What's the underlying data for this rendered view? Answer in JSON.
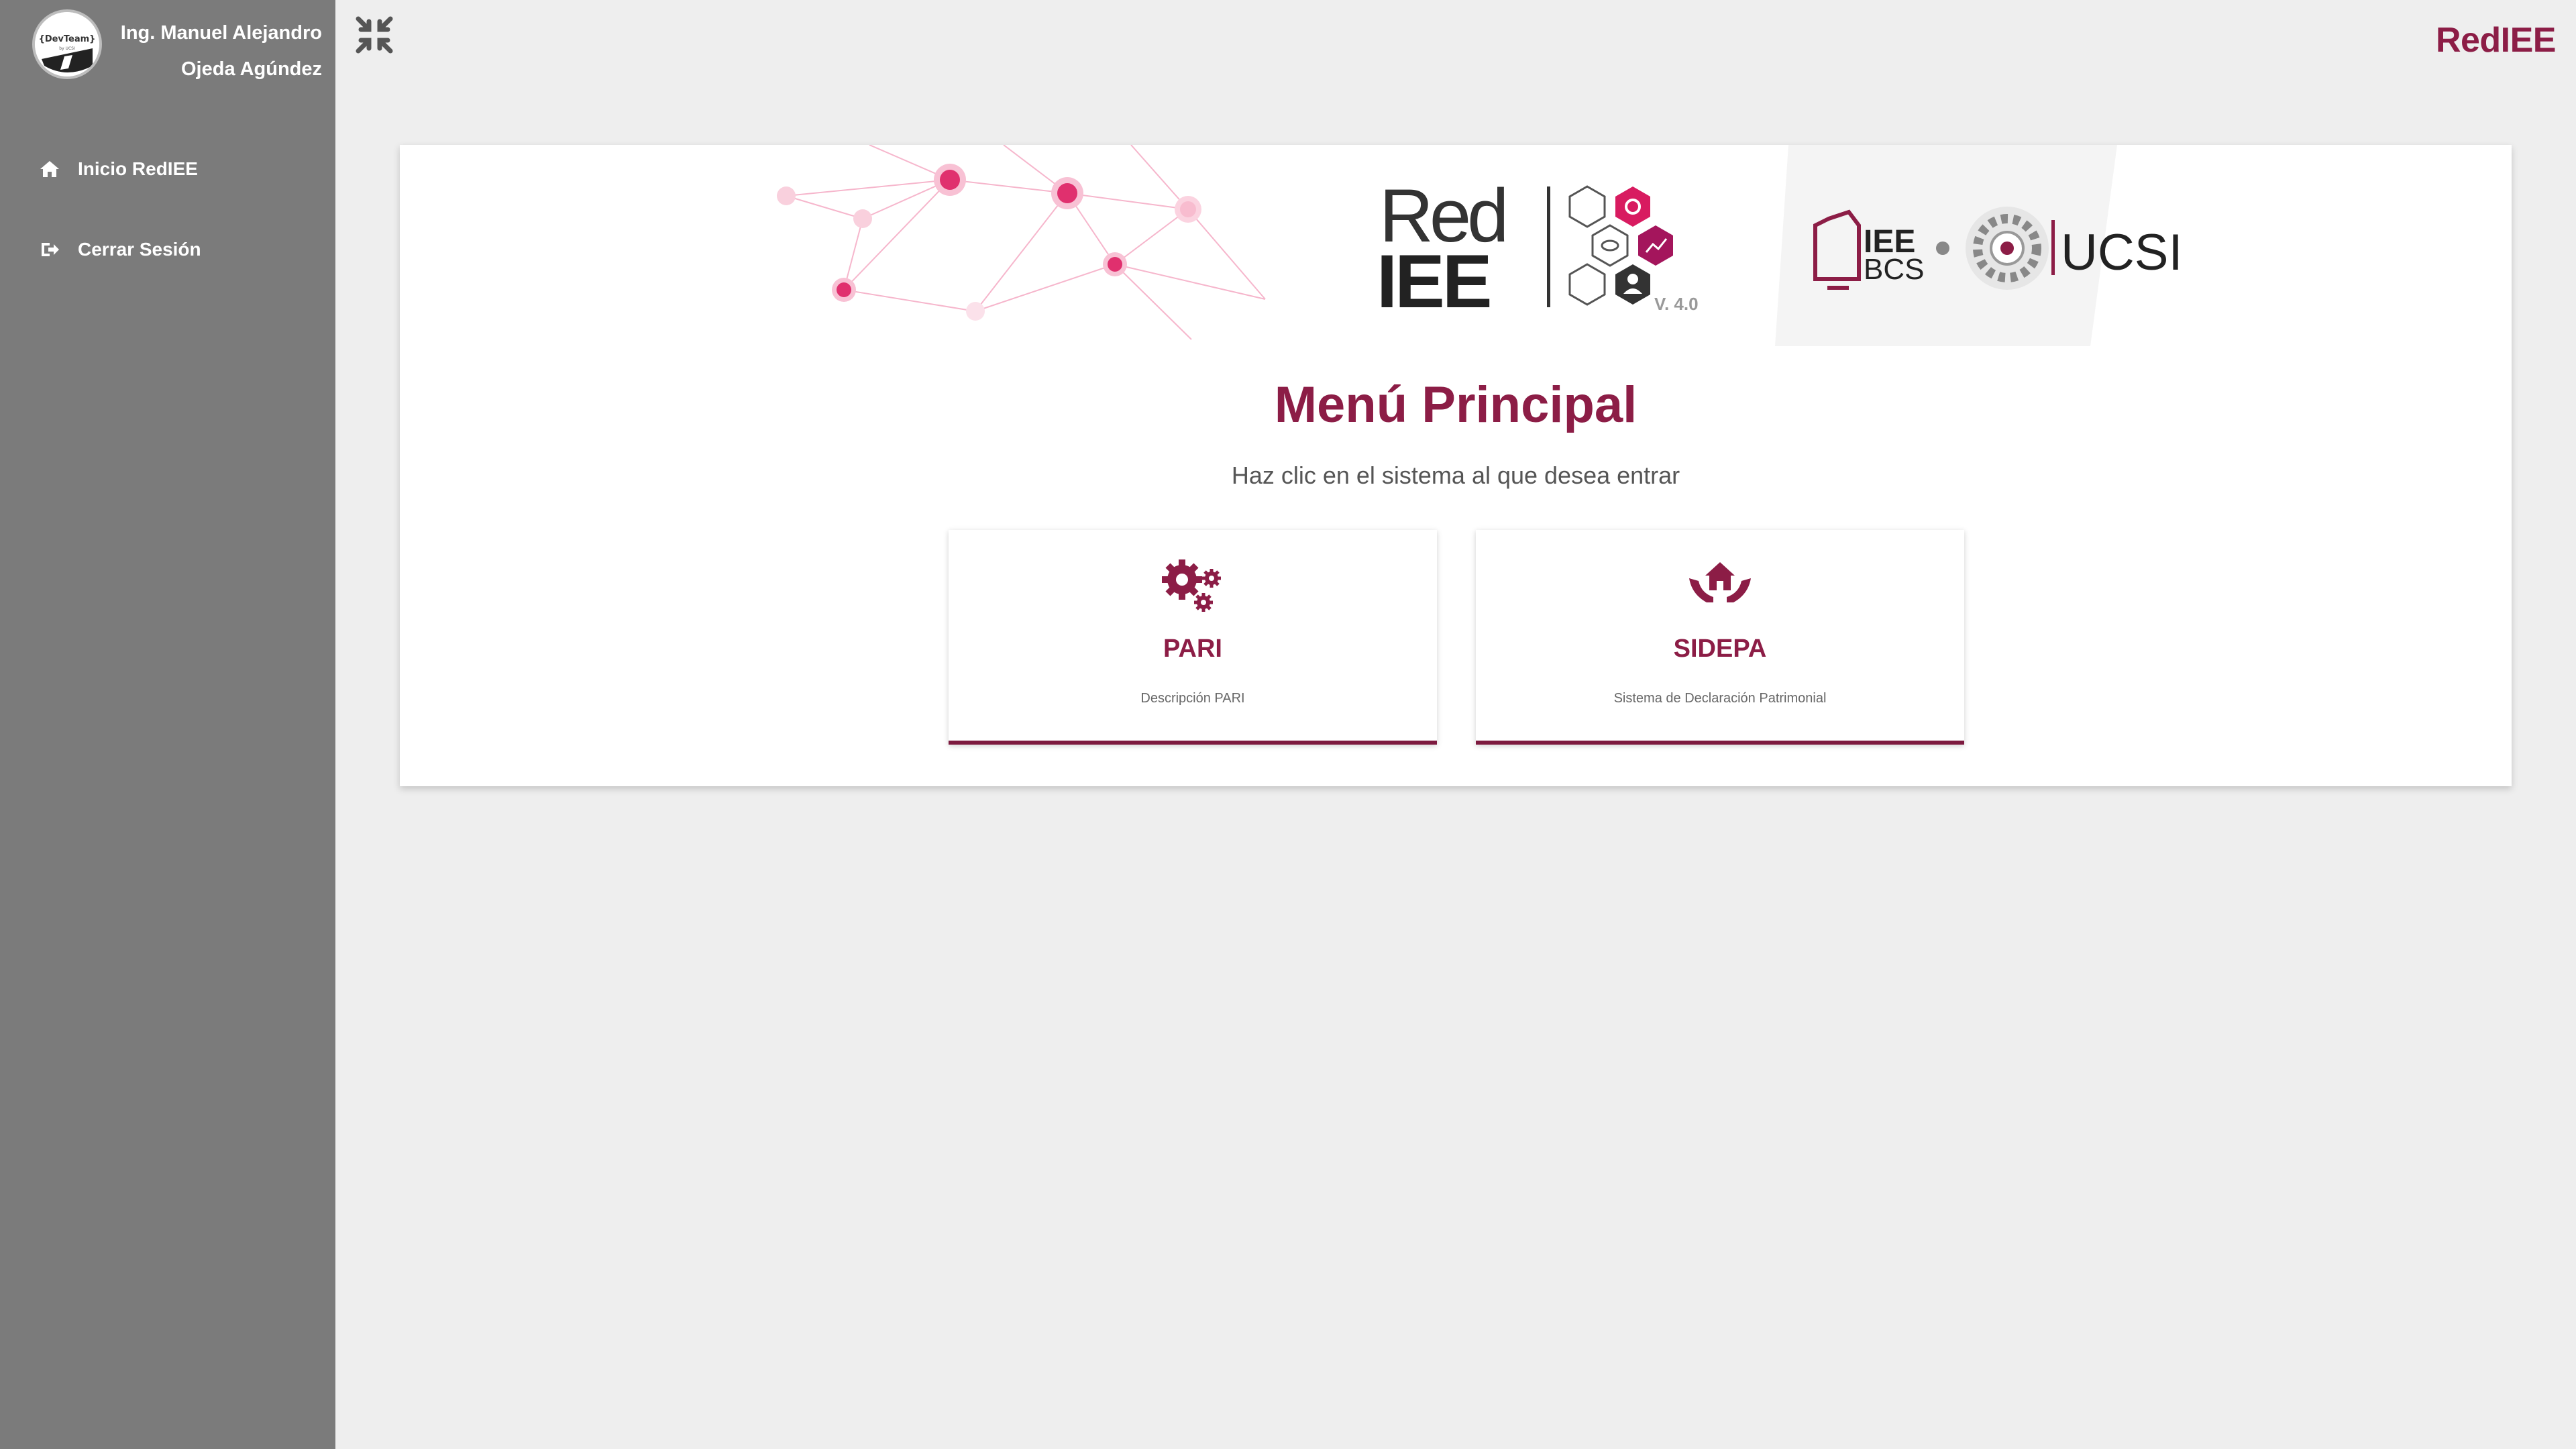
{
  "user": {
    "name_line1": "Ing. Manuel Alejandro",
    "name_line2": "Ojeda Agúndez",
    "avatar_text": "{DevTeam}",
    "avatar_subtext": "by UCSI"
  },
  "sidebar": {
    "items": [
      {
        "label": "Inicio RedIEE",
        "icon": "home-icon"
      },
      {
        "label": "Cerrar Sesión",
        "icon": "sign-out-icon"
      }
    ]
  },
  "header": {
    "brand": "RedIEE",
    "collapse_icon": "compress-icon"
  },
  "banner": {
    "logo_red": "Red",
    "logo_iee": "IEE",
    "version": "V. 4.0",
    "partner1_line1": "IEE",
    "partner1_line2": "BCS",
    "partner2": "UCSI"
  },
  "main": {
    "title": "Menú Principal",
    "subtitle": "Haz clic en el sistema al que desea entrar",
    "systems": [
      {
        "name": "PARI",
        "description": "Descripción PARI",
        "icon": "gears-icon"
      },
      {
        "name": "SIDEPA",
        "description": "Sistema de Declaración Patrimonial",
        "icon": "hands-house-icon"
      }
    ]
  },
  "colors": {
    "brand": "#8c1d46",
    "sidebar": "#7b7b7b",
    "background": "#eeeeee",
    "accent_pink": "#e0306e"
  }
}
